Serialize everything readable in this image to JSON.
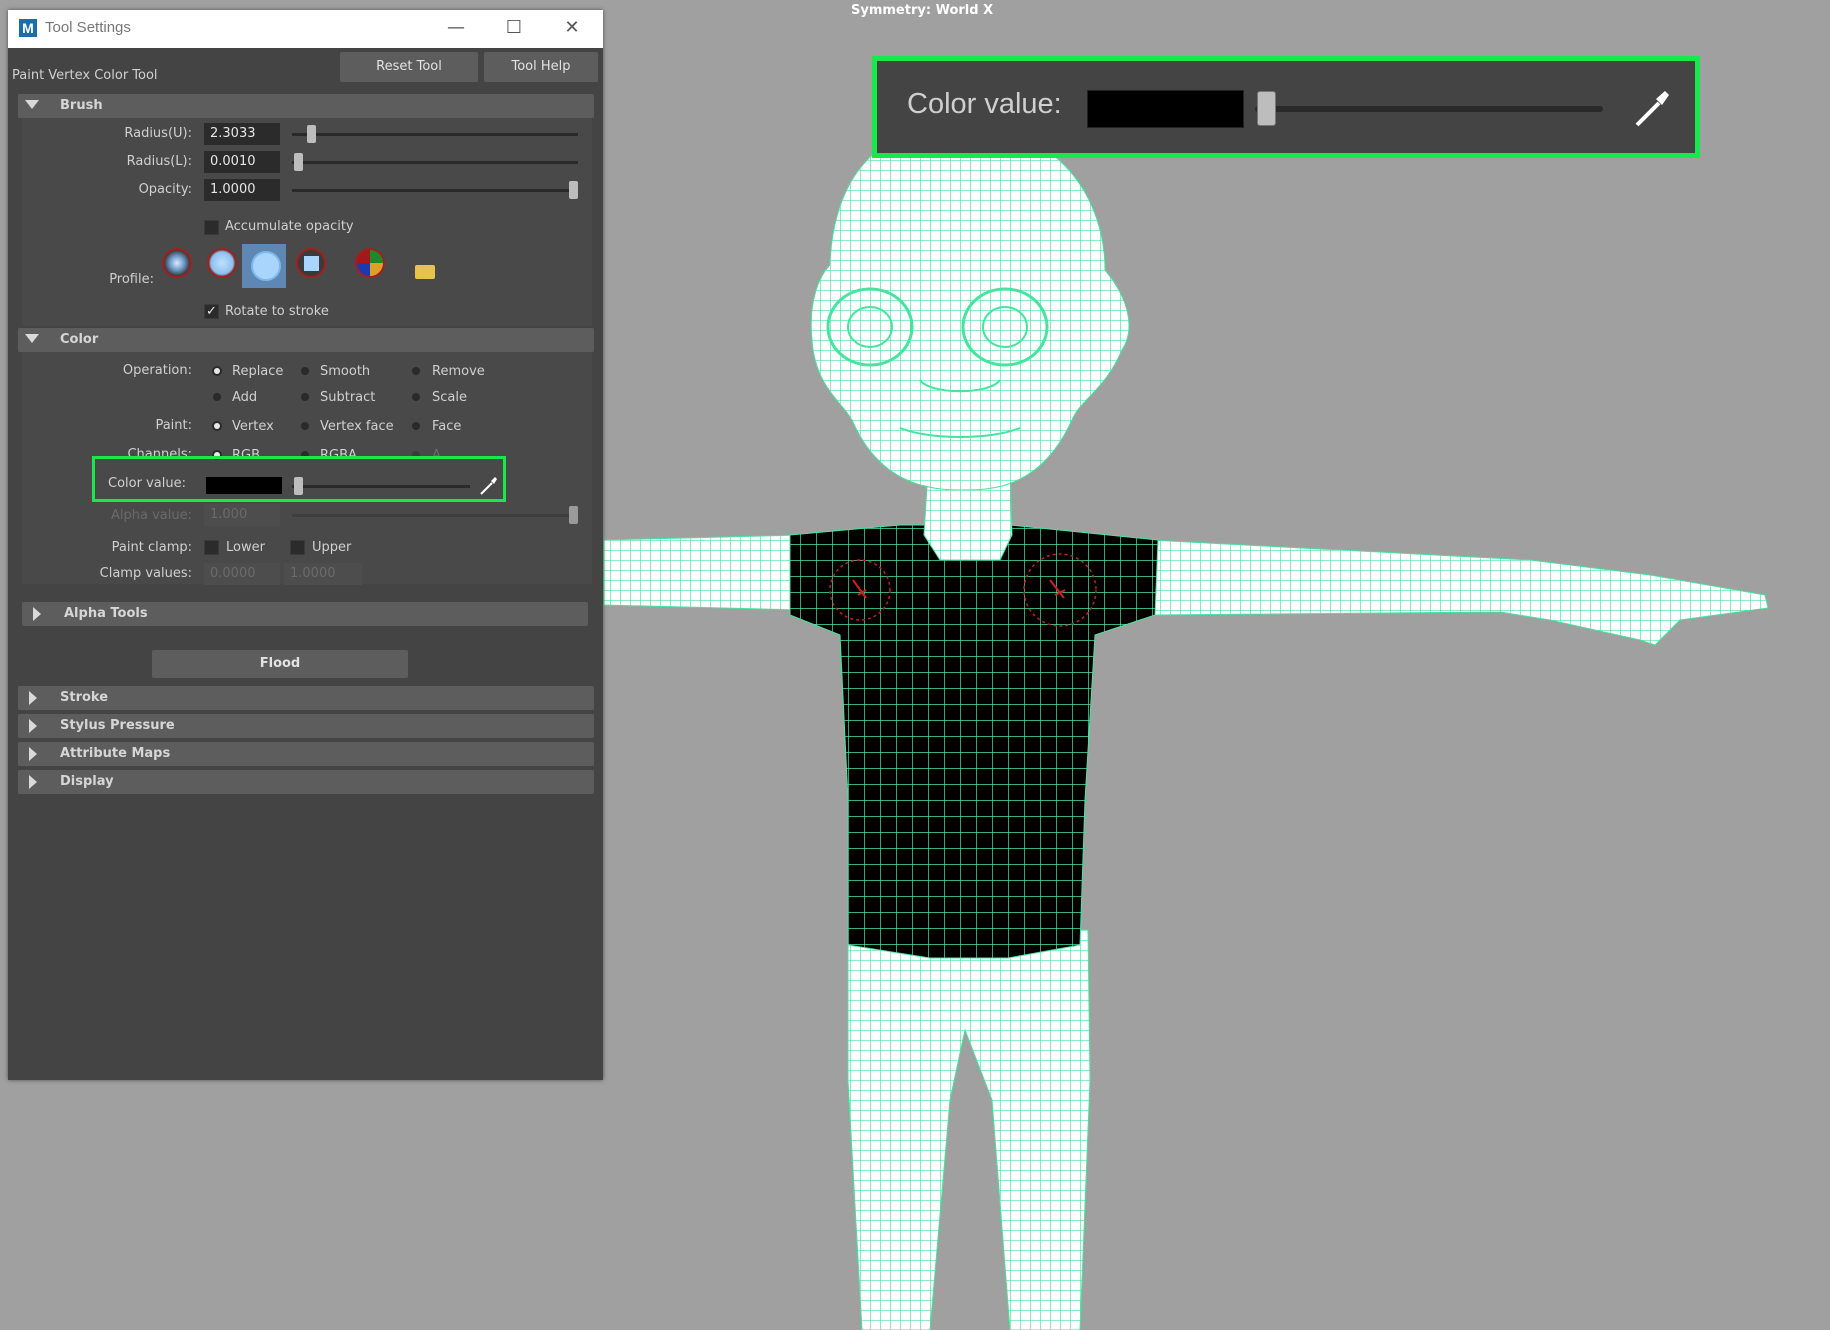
{
  "viewport": {
    "symmetry": "Symmetry: World X",
    "zoom": {
      "label": "Color value:",
      "color": "#000000",
      "slider_value": 0.0
    }
  },
  "window": {
    "title": "Tool Settings",
    "tool_name": "Paint Vertex Color Tool",
    "reset_label": "Reset Tool",
    "help_label": "Tool Help"
  },
  "brush": {
    "section": "Brush",
    "radius_u_label": "Radius(U):",
    "radius_u": "2.3033",
    "radius_l_label": "Radius(L):",
    "radius_l": "0.0010",
    "opacity_label": "Opacity:",
    "opacity": "1.0000",
    "accumulate_label": "Accumulate opacity",
    "profile_label": "Profile:",
    "rotate_label": "Rotate to stroke"
  },
  "color": {
    "section": "Color",
    "operation_label": "Operation:",
    "operations": [
      "Replace",
      "Smooth",
      "Remove",
      "Add",
      "Subtract",
      "Scale"
    ],
    "operation_selected": "Replace",
    "paint_label": "Paint:",
    "paint_options": [
      "Vertex",
      "Vertex face",
      "Face"
    ],
    "channels_label": "Channels:",
    "channel_options": [
      "RGB",
      "RGBA",
      "A"
    ],
    "color_value_label": "Color value:",
    "alpha_value_label": "Alpha value:",
    "alpha_value": "1.000",
    "clamp_label": "Paint clamp:",
    "clamp_lower": "Lower",
    "clamp_upper": "Upper",
    "clamp_values_label": "Clamp values:",
    "clamp_min": "0.0000",
    "clamp_max": "1.0000",
    "alpha_tools": "Alpha Tools",
    "flood": "Flood"
  },
  "sections": [
    "Stroke",
    "Stylus Pressure",
    "Attribute Maps",
    "Display"
  ],
  "colors": {
    "highlight": "#19e84c",
    "wire": "#5df0b0",
    "panel": "#444444"
  }
}
